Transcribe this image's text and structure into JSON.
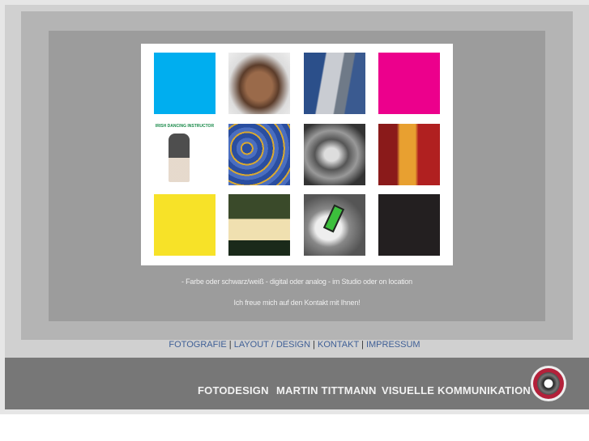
{
  "gallery": {
    "tiles": [
      {
        "name": "cyan",
        "color": "#00aeef"
      },
      {
        "name": "sculpture"
      },
      {
        "name": "skyscraper"
      },
      {
        "name": "magenta",
        "color": "#ec008c"
      },
      {
        "name": "irish-dancing-poster",
        "title": "IRISH DANCING INSTRUCTOR"
      },
      {
        "name": "blue-gold-texture"
      },
      {
        "name": "rock-bw"
      },
      {
        "name": "beer"
      },
      {
        "name": "yellow",
        "color": "#f7e228"
      },
      {
        "name": "storefront-night"
      },
      {
        "name": "ring"
      },
      {
        "name": "black",
        "color": "#231f20"
      }
    ]
  },
  "captions": {
    "line1": "- Farbe oder schwarz/weiß - digital oder analog - im Studio oder on location",
    "line2": "Ich freue mich auf den Kontakt mit Ihnen!"
  },
  "nav": {
    "items": [
      "FOTOGRAFIE",
      "LAYOUT / DESIGN",
      "KONTAKT",
      "IMPRESSUM"
    ],
    "separator": "|"
  },
  "footer": {
    "brand": [
      "FOTODESIGN",
      "MARTIN TITTMANN",
      "VISUELLE KOMMUNIKATION"
    ],
    "logo_icon": "camera-lens-icon"
  }
}
